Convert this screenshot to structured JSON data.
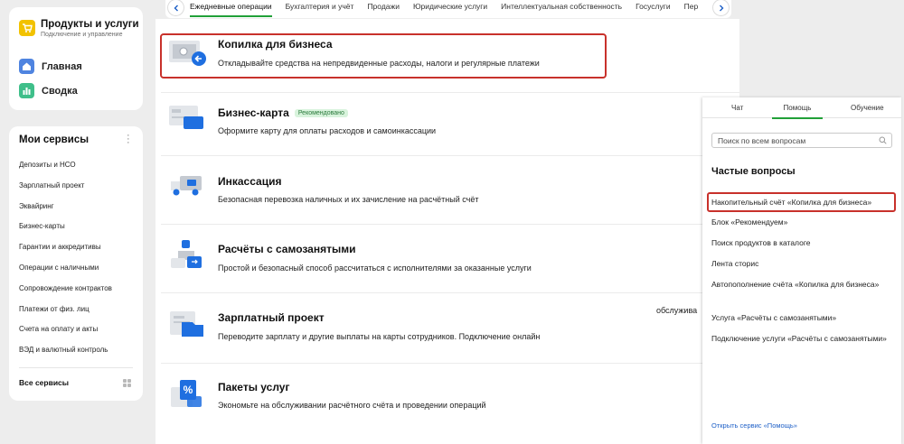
{
  "sidebar": {
    "brand_title": "Продукты и услуги",
    "brand_subtitle": "Подключение и управление",
    "nav": [
      {
        "label": "Главная",
        "icon": "home-icon"
      },
      {
        "label": "Сводка",
        "icon": "chart-icon"
      }
    ],
    "services_title": "Мои сервисы",
    "services": [
      "Депозиты и НСО",
      "Зарплатный проект",
      "Эквайринг",
      "Бизнес-карты",
      "Гарантии и аккредитивы",
      "Операции с наличными",
      "Сопровождение контрактов",
      "Платежи от физ. лиц",
      "Счета на оплату и акты",
      "ВЭД и валютный контроль"
    ],
    "all_services": "Все сервисы"
  },
  "tabs": [
    {
      "label": "Ежедневные операции",
      "active": true
    },
    {
      "label": "Бухгалтерия и учёт"
    },
    {
      "label": "Продажи"
    },
    {
      "label": "Юридические услуги"
    },
    {
      "label": "Интеллектуальная собственность"
    },
    {
      "label": "Госуслуги"
    },
    {
      "label": "Пер"
    }
  ],
  "products": [
    {
      "title": "Копилка для бизнеса",
      "desc": "Откладывайте средства на непредвиденные расходы, налоги и регулярные платежи",
      "highlighted": true,
      "icon": "piggy-bank-icon"
    },
    {
      "title": "Бизнес-карта",
      "badge": "Рекомендовано",
      "desc": "Оформите карту для оплаты расходов и самоинкассации",
      "icon": "card-icon"
    },
    {
      "title": "Инкассация",
      "desc": "Безопасная перевозка наличных и их зачисление на расчётный счёт",
      "icon": "truck-icon"
    },
    {
      "title": "Расчёты с самозанятыми",
      "desc": "Простой и безопасный способ рассчитаться с исполнителями за оказанные услуги",
      "icon": "person-icon"
    },
    {
      "title": "Зарплатный проект",
      "desc": "Переводите зарплату и другие выплаты на карты сотрудников. Подключение онлайн",
      "icon": "payroll-icon"
    },
    {
      "title": "Пакеты услуг",
      "desc": "Экономьте на обслуживании расчётного счёта и проведении операций",
      "icon": "percent-icon"
    }
  ],
  "cut_text": "обслужива",
  "help": {
    "tabs": [
      "Чат",
      "Помощь",
      "Обучение"
    ],
    "active_tab": "Помощь",
    "search_placeholder": "Поиск по всем вопросам",
    "faq_title": "Частые вопросы",
    "faq": [
      "Накопительный счёт «Копилка для бизнеса»",
      "Блок «Рекомендуем»",
      "Поиск продуктов в каталоге",
      "Лента сторис",
      "Автопополнение счёта «Копилка для бизнеса»",
      "Услуга «Расчёты с самозанятыми»",
      "Подключение услуги «Расчёты с самозанятыми»"
    ],
    "link": "Открыть сервис «Помощь»"
  },
  "colors": {
    "accent_green": "#21a038",
    "highlight_red": "#c8312b",
    "brand_yellow": "#f2c200",
    "icon_blue": "#1f6fe0"
  }
}
